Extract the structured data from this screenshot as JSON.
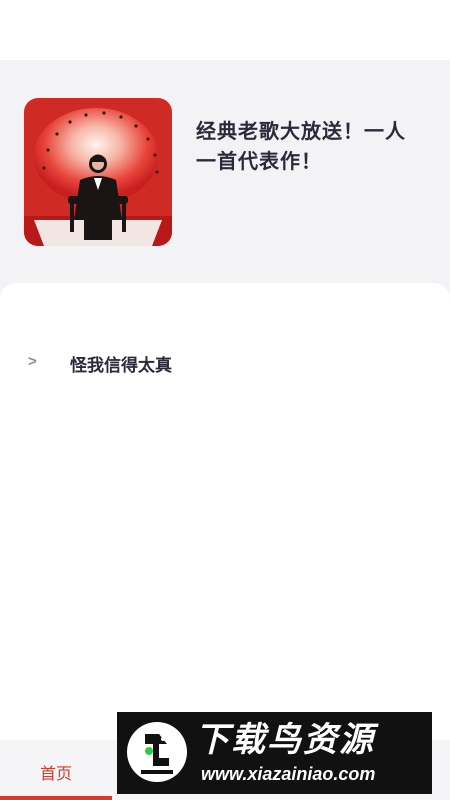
{
  "album": {
    "title": "经典老歌大放送！一人一首代表作！",
    "cover_icon": "album-cover-image"
  },
  "songs": [
    {
      "marker": ">",
      "title": "怪我信得太真"
    }
  ],
  "tabbar": {
    "home_label": "首页",
    "active_color": "#d83a2c"
  },
  "watermark": {
    "name": "下载鸟资源",
    "url": "www.xiazainiao.com"
  },
  "colors": {
    "header_bg": "#f3f2f4",
    "text_primary": "#2b2a3a",
    "accent": "#d83a2c"
  }
}
